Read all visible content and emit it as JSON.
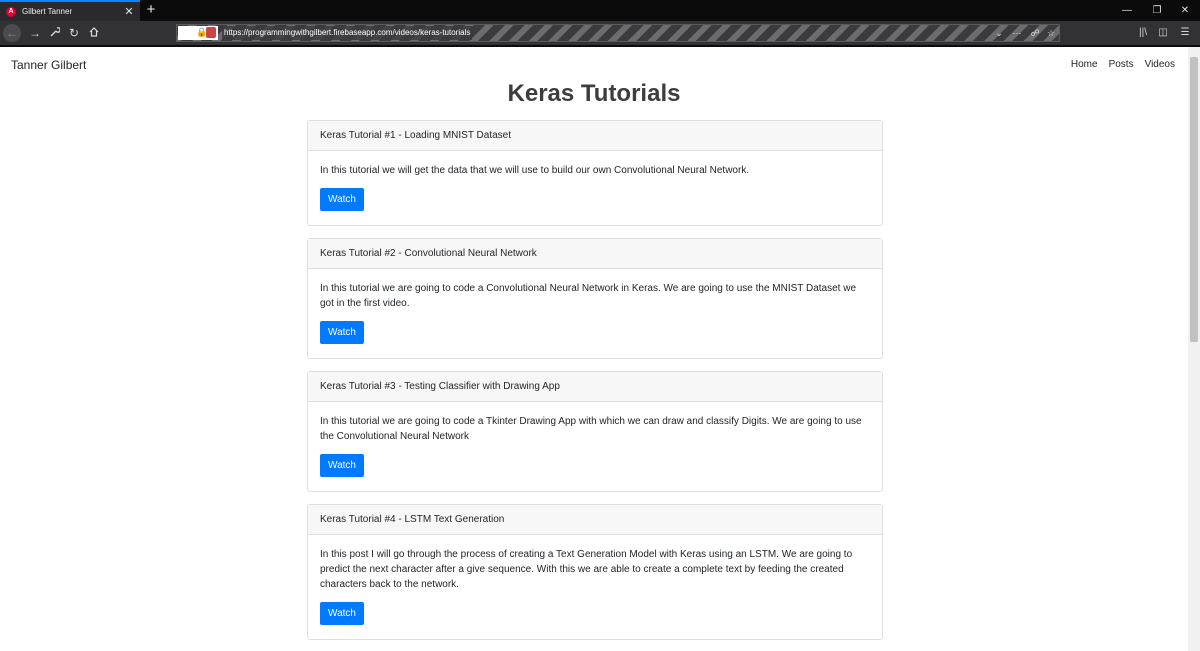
{
  "browser": {
    "tab_title": "Gilbert Tanner",
    "tab_close": "✕",
    "new_tab": "+",
    "url": "https://programmingwithgilbert.firebaseapp.com/videos/keras-tutorials",
    "favicon_letter": "A",
    "icons": {
      "back": "back-arrow-icon",
      "forward": "forward-arrow-icon",
      "tools": "wrench-icon",
      "reload": "reload-icon",
      "home": "home-icon",
      "lock": "lock-icon",
      "dropdown": "chevron-down-icon",
      "more": "more-icon",
      "pocket": "pocket-icon",
      "bookmark": "star-icon",
      "library": "library-icon",
      "sidebar": "sidebar-icon",
      "menu": "hamburger-icon"
    }
  },
  "site": {
    "brand": "Tanner Gilbert",
    "nav": [
      {
        "label": "Home"
      },
      {
        "label": "Posts"
      },
      {
        "label": "Videos"
      }
    ]
  },
  "page_title": "Keras Tutorials",
  "cards": [
    {
      "title": "Keras Tutorial #1 - Loading MNIST Dataset",
      "description": "In this tutorial we will get the data that we will use to build our own Convolutional Neural Network.",
      "button": "Watch"
    },
    {
      "title": "Keras Tutorial #2 - Convolutional Neural Network",
      "description": "In this tutorial we are going to code a Convolutional Neural Network in Keras. We are going to use the MNIST Dataset we got in the first video.",
      "button": "Watch"
    },
    {
      "title": "Keras Tutorial #3 - Testing Classifier with Drawing App",
      "description": "In this tutorial we are going to code a Tkinter Drawing App with which we can draw and classify Digits. We are going to use the Convolutional Neural Network",
      "button": "Watch"
    },
    {
      "title": "Keras Tutorial #4 - LSTM Text Generation",
      "description": "In this post I will go through the process of creating a Text Generation Model with Keras using an LSTM. We are going to predict the next character after a give sequence. With this we are able to create a complete text by feeding the created characters back to the network.",
      "button": "Watch"
    }
  ],
  "colors": {
    "accent": "#007bff",
    "tab_highlight": "#0a84ff",
    "title_text": "#3d3d3d"
  }
}
